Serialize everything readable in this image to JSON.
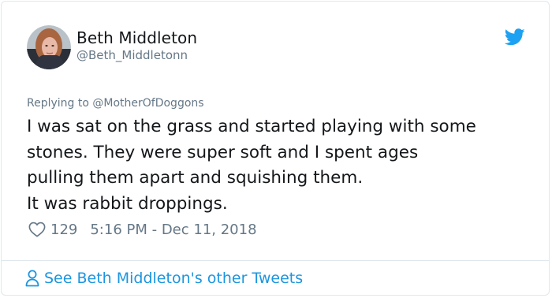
{
  "tweet": {
    "author_name": "Beth Middleton",
    "author_handle": "@Beth_Middletonn",
    "replying_prefix": "Replying to ",
    "replying_to": "@MotherOfDoggons",
    "text": "I was sat on the grass and started playing with some\nstones. They were super soft and I spent ages\npulling them apart and squishing them.\nIt was rabbit droppings.",
    "likes": "129",
    "timestamp": "5:16 PM - Dec 11, 2018"
  },
  "footer": {
    "link_text": "See Beth Middleton's other Tweets"
  },
  "icons": {
    "platform": "twitter-bird-icon",
    "like": "heart-icon",
    "profile": "person-icon"
  },
  "colors": {
    "brand_blue": "#1da1f2",
    "link_blue": "#1b95e0",
    "muted": "#657786",
    "text": "#14171a",
    "border": "#e1e8ed"
  }
}
